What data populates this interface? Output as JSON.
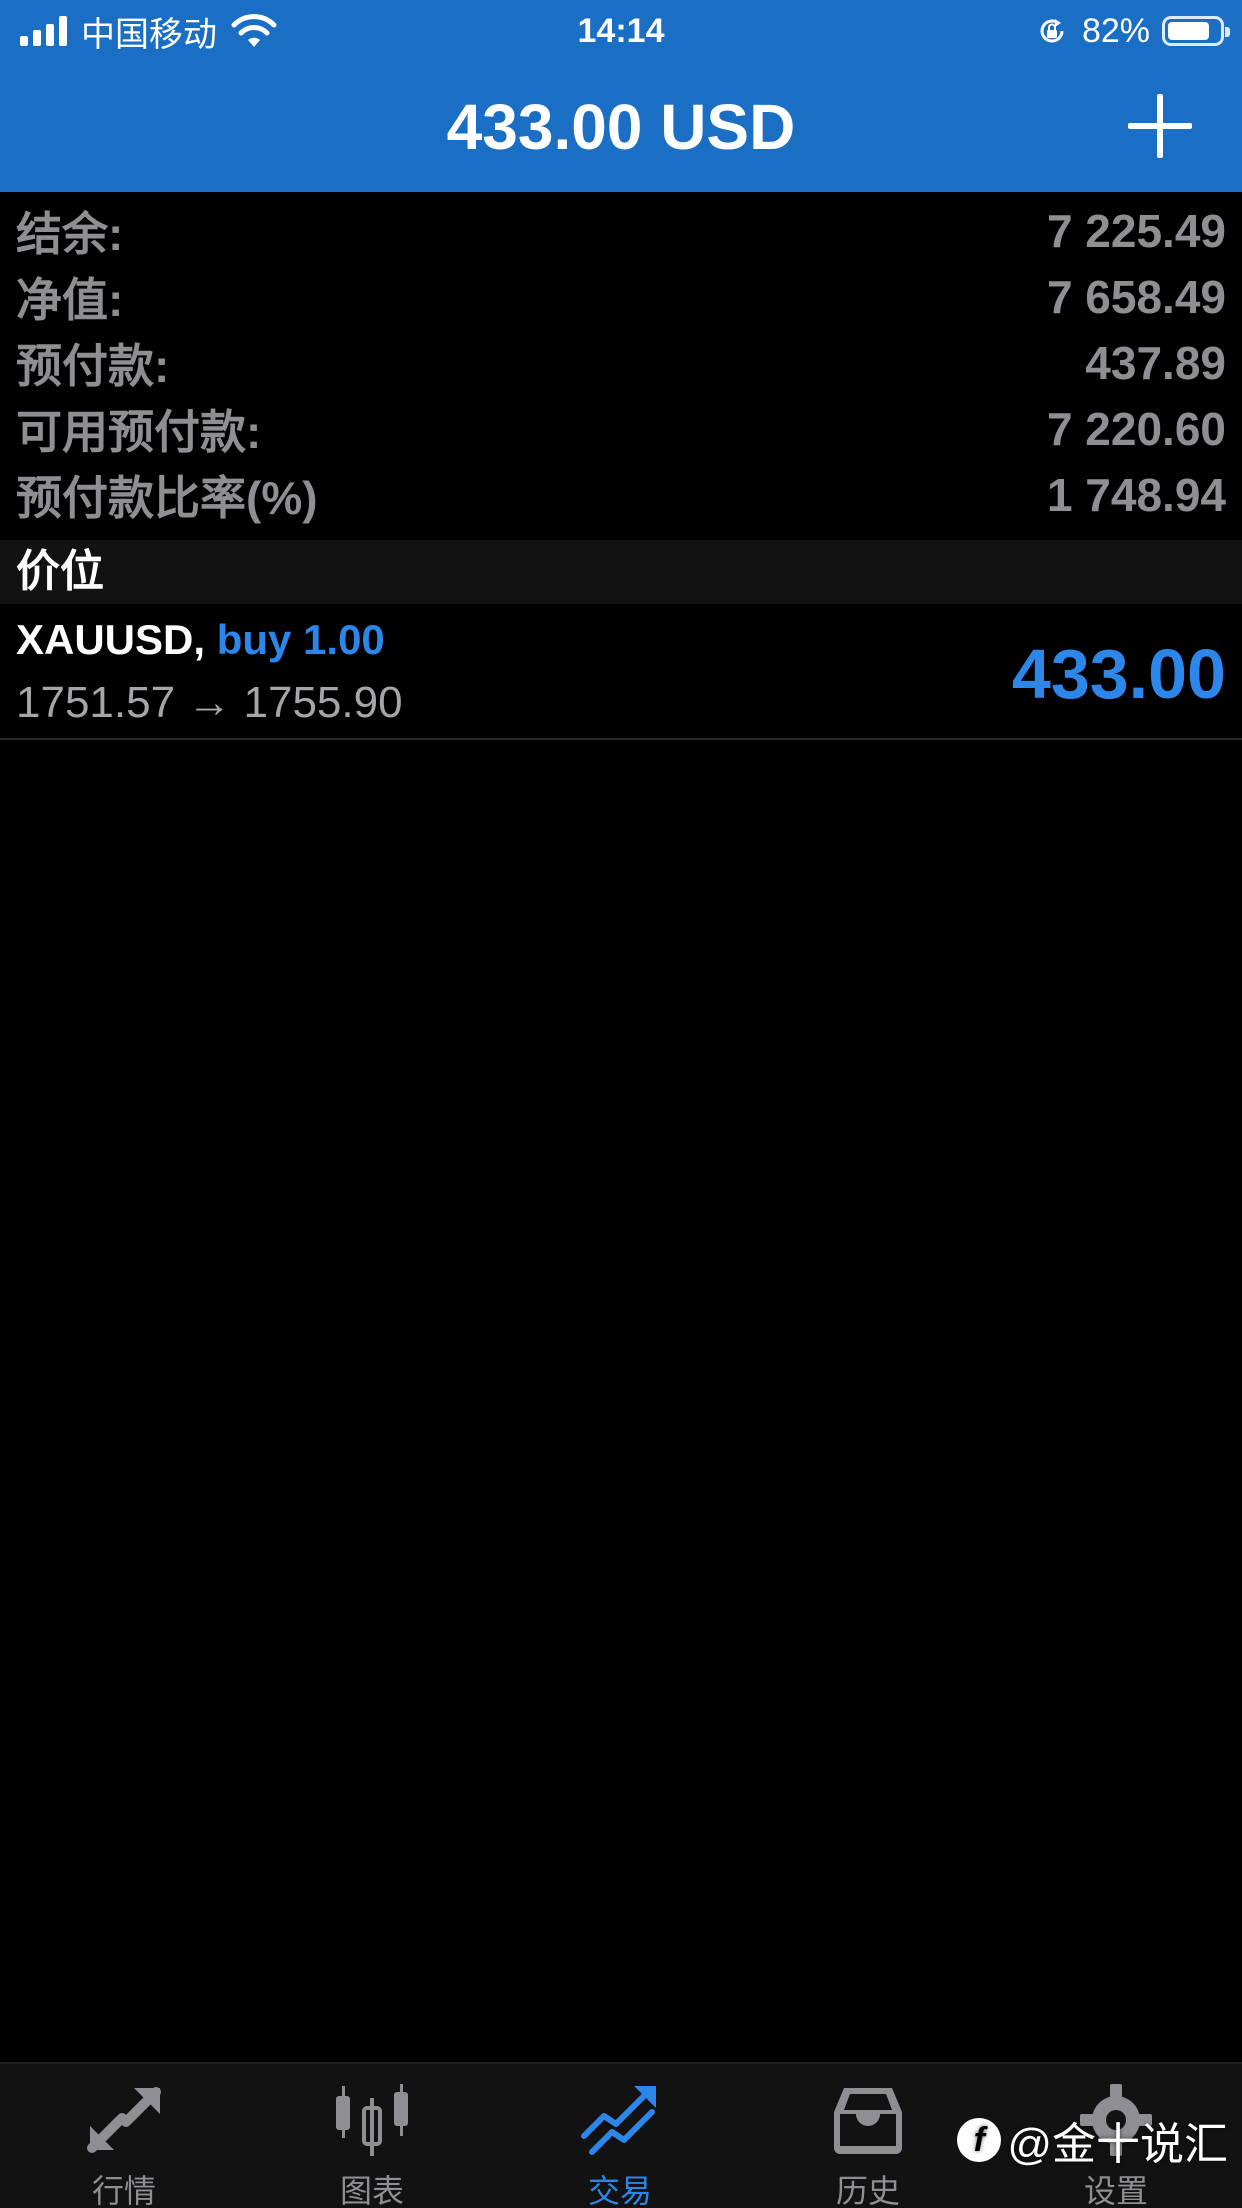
{
  "status_bar": {
    "carrier": "中国移动",
    "time": "14:14",
    "battery_percent": "82%",
    "battery_level": 0.82,
    "icons": [
      "signal-icon",
      "wifi-icon",
      "rotation-lock-icon",
      "battery-icon"
    ]
  },
  "header": {
    "title": "433.00 USD",
    "action_icon": "plus-icon"
  },
  "summary": {
    "rows": [
      {
        "label": "结余:",
        "value": "7 225.49"
      },
      {
        "label": "净值:",
        "value": "7 658.49"
      },
      {
        "label": "预付款:",
        "value": "437.89"
      },
      {
        "label": "可用预付款:",
        "value": "7 220.60"
      },
      {
        "label": "预付款比率(%)",
        "value": "1 748.94"
      }
    ]
  },
  "positions": {
    "section_title": "价位",
    "items": [
      {
        "symbol": "XAUUSD,",
        "side": "buy 1.00",
        "prices": "1751.57 → 1755.90",
        "profit": "433.00"
      }
    ]
  },
  "tab_bar": {
    "tabs": [
      {
        "label": "行情",
        "icon": "quotes-icon",
        "active": false
      },
      {
        "label": "图表",
        "icon": "chart-icon",
        "active": false
      },
      {
        "label": "交易",
        "icon": "trade-icon",
        "active": true
      },
      {
        "label": "历史",
        "icon": "history-icon",
        "active": false
      },
      {
        "label": "设置",
        "icon": "settings-icon",
        "active": false
      }
    ]
  },
  "watermark": {
    "logo": "f",
    "text": "@金十说汇"
  },
  "colors": {
    "header_bg": "#1a6fc4",
    "accent_blue": "#2d86ea",
    "label_gray": "#8e8e93",
    "background": "#000000"
  }
}
